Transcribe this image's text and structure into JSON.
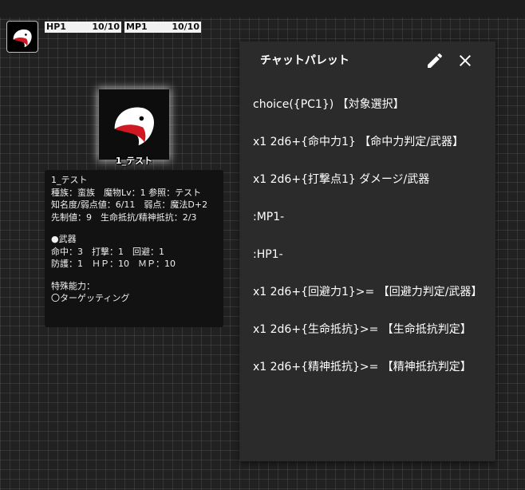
{
  "stats": {
    "hp": {
      "label": "HP1",
      "value": "10/10"
    },
    "mp": {
      "label": "MP1",
      "value": "10/10"
    }
  },
  "token": {
    "name": "1_テスト",
    "icon": "bird-head-icon"
  },
  "info": {
    "lines_a": [
      "1_テスト",
      "種族：蛮族　魔物Lv：1 参照：テスト",
      "知名度/弱点値：6/11　弱点：魔法D+2",
      "先制値：9　生命抵抗/精神抵抗：2/3"
    ],
    "lines_b": [
      "●武器",
      "命中：3　打撃：1　回避：1",
      "防護：1　ＨＰ：10　ＭＰ：10"
    ],
    "lines_c": [
      "特殊能力：",
      "〇ターゲッティング"
    ]
  },
  "palette": {
    "title": "チャットパレット",
    "edit_icon": "pencil-icon",
    "close_icon": "close-icon",
    "items": [
      "choice({PC1}) 【対象選択】",
      "x1 2d6+{命中力1} 【命中力判定/武器】",
      "x1 2d6+{打撃点1} ダメージ/武器",
      ":MP1-",
      ":HP1-",
      "x1 2d6+{回避力1}>= 【回避力判定/武器】",
      "x1 2d6+{生命抵抗}>= 【生命抵抗判定】",
      "x1 2d6+{精神抵抗}>= 【精神抵抗判定】"
    ]
  }
}
